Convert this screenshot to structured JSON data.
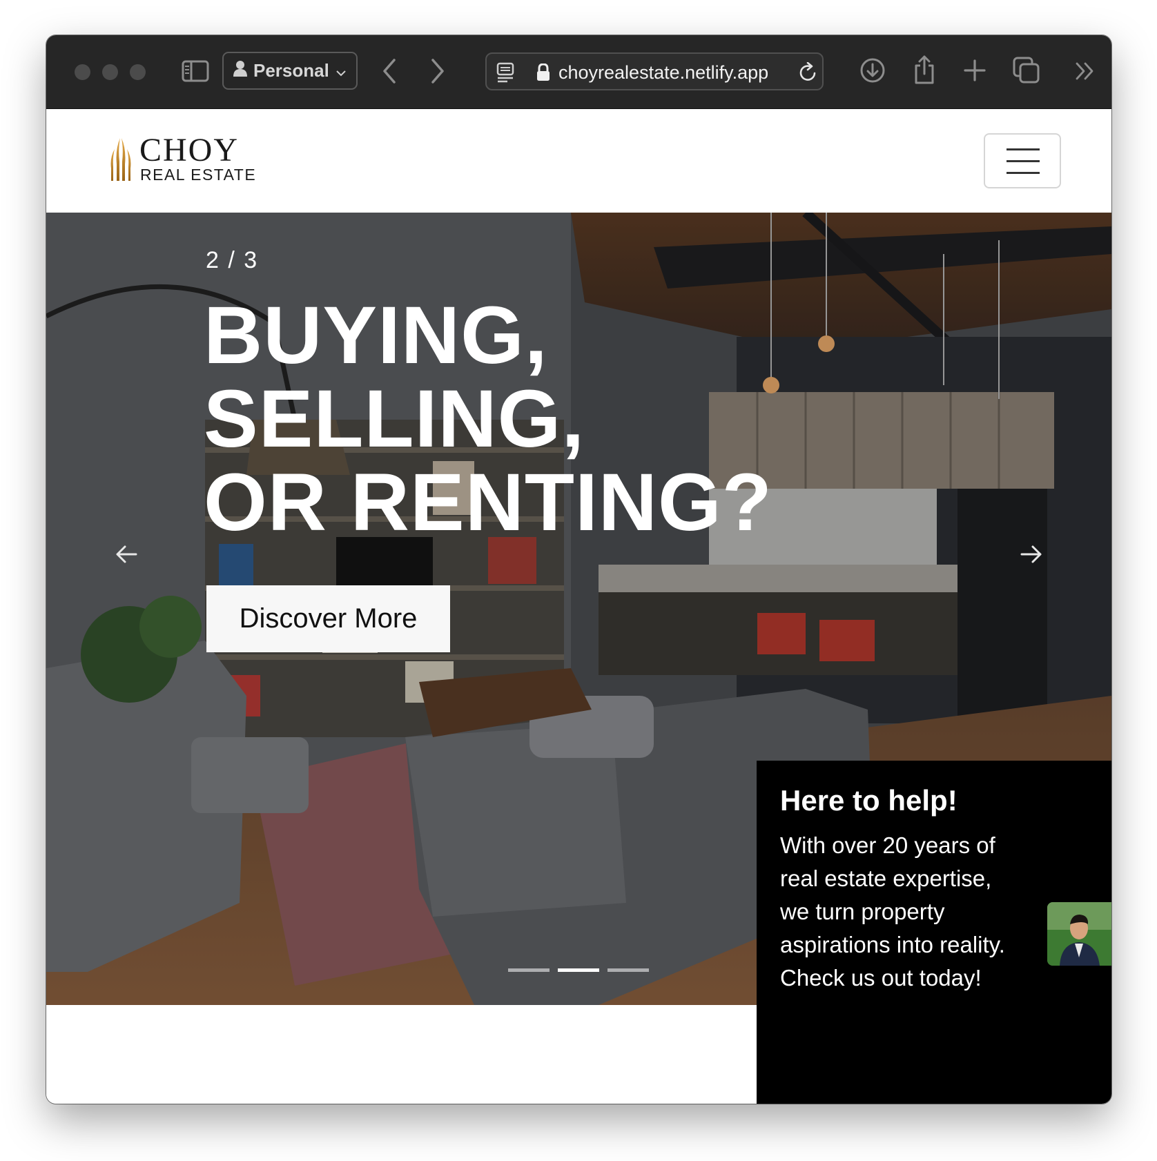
{
  "browser": {
    "profile_label": "Personal",
    "url": "choyrealestate.netlify.app"
  },
  "site": {
    "brand_name": "CHOY",
    "brand_sub": "REAL ESTATE",
    "colors": {
      "logo_gold": "#c8922a",
      "panel_bg": "#000000"
    }
  },
  "hero": {
    "slide_counter": "2 / 3",
    "headline_lines": [
      "BUYING,",
      "SELLING,",
      "OR RENTING?"
    ],
    "cta_label": "Discover More",
    "current_slide": 2,
    "total_slides": 3
  },
  "help": {
    "title": "Here to help!",
    "body": "With over 20 years of real estate expertise, we turn property aspirations into reality. Check us out today!"
  }
}
